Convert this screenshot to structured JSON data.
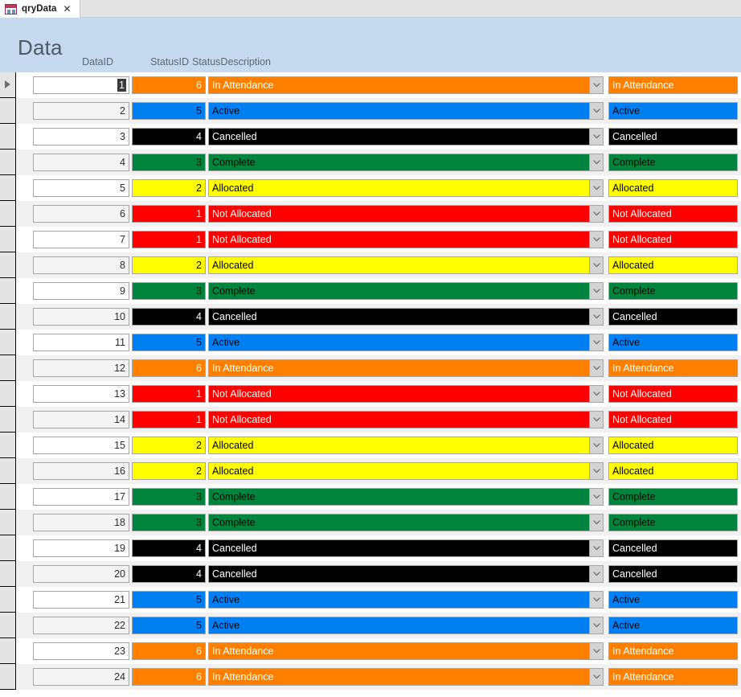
{
  "tab": {
    "icon": "query-datasheet-icon",
    "label": "qryData",
    "close_label": "✕"
  },
  "form": {
    "title": "Data",
    "headers": {
      "dataid": "DataID",
      "statusid": "StatusID",
      "statusdescription": "StatusDescription"
    },
    "header_bg": "#c6d9ef"
  },
  "status_colors": {
    "1": {
      "bg": "#ff0000",
      "fg": "#ffffff"
    },
    "2": {
      "bg": "#ffff00",
      "fg": "#000000"
    },
    "3": {
      "bg": "#00843d",
      "fg": "#000000"
    },
    "4": {
      "bg": "#000000",
      "fg": "#ffffff"
    },
    "5": {
      "bg": "#0080f0",
      "fg": "#000000"
    },
    "6": {
      "bg": "#ff8000",
      "fg": "#ffffff"
    }
  },
  "rows": [
    {
      "dataid": "1",
      "statusid": "6",
      "description": "In Attendance",
      "focused": true
    },
    {
      "dataid": "2",
      "statusid": "5",
      "description": "Active"
    },
    {
      "dataid": "3",
      "statusid": "4",
      "description": "Cancelled"
    },
    {
      "dataid": "4",
      "statusid": "3",
      "description": "Complete"
    },
    {
      "dataid": "5",
      "statusid": "2",
      "description": "Allocated"
    },
    {
      "dataid": "6",
      "statusid": "1",
      "description": "Not Allocated"
    },
    {
      "dataid": "7",
      "statusid": "1",
      "description": "Not Allocated"
    },
    {
      "dataid": "8",
      "statusid": "2",
      "description": "Allocated"
    },
    {
      "dataid": "9",
      "statusid": "3",
      "description": "Complete"
    },
    {
      "dataid": "10",
      "statusid": "4",
      "description": "Cancelled"
    },
    {
      "dataid": "11",
      "statusid": "5",
      "description": "Active"
    },
    {
      "dataid": "12",
      "statusid": "6",
      "description": "In Attendance"
    },
    {
      "dataid": "13",
      "statusid": "1",
      "description": "Not Allocated"
    },
    {
      "dataid": "14",
      "statusid": "1",
      "description": "Not Allocated"
    },
    {
      "dataid": "15",
      "statusid": "2",
      "description": "Allocated"
    },
    {
      "dataid": "16",
      "statusid": "2",
      "description": "Allocated"
    },
    {
      "dataid": "17",
      "statusid": "3",
      "description": "Complete"
    },
    {
      "dataid": "18",
      "statusid": "3",
      "description": "Complete"
    },
    {
      "dataid": "19",
      "statusid": "4",
      "description": "Cancelled"
    },
    {
      "dataid": "20",
      "statusid": "4",
      "description": "Cancelled"
    },
    {
      "dataid": "21",
      "statusid": "5",
      "description": "Active"
    },
    {
      "dataid": "22",
      "statusid": "5",
      "description": "Active"
    },
    {
      "dataid": "23",
      "statusid": "6",
      "description": "In Attendance"
    },
    {
      "dataid": "24",
      "statusid": "6",
      "description": "In Attendance"
    }
  ]
}
